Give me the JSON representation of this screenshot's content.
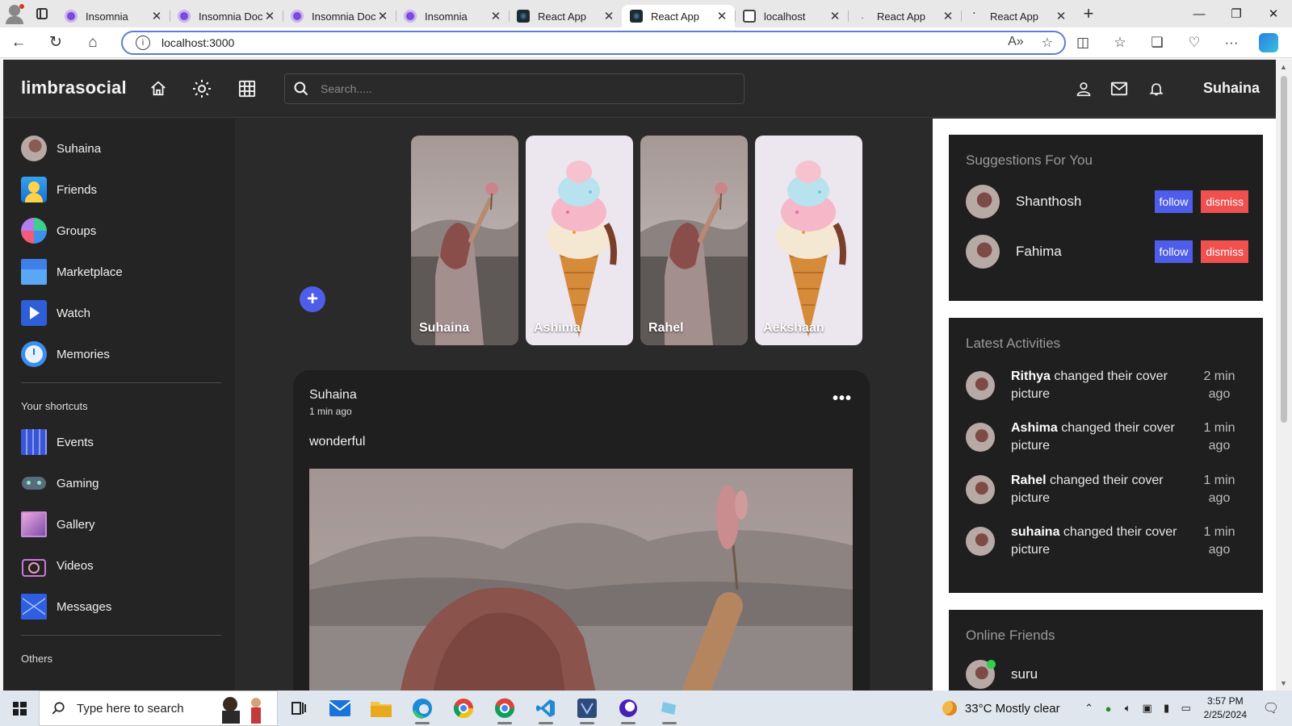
{
  "browser": {
    "tabs": [
      {
        "label": "Insomnia",
        "icon": "insomnia-icon",
        "active": false
      },
      {
        "label": "Insomnia Doc",
        "icon": "insomnia-icon",
        "active": false
      },
      {
        "label": "Insomnia Doc",
        "icon": "insomnia-icon",
        "active": false
      },
      {
        "label": "Insomnia",
        "icon": "insomnia-icon",
        "active": false
      },
      {
        "label": "React App",
        "icon": "react-icon",
        "active": false
      },
      {
        "label": "React App",
        "icon": "react-icon",
        "active": true
      },
      {
        "label": "localhost",
        "icon": "page-icon",
        "active": false
      },
      {
        "label": "React App",
        "icon": "dot-icon",
        "active": false
      },
      {
        "label": "React App",
        "icon": "dot-icon",
        "active": false
      }
    ],
    "url": "localhost:3000",
    "accent": "#5c7fd1"
  },
  "app": {
    "brand": "limbrasocial",
    "search_placeholder": "Search.....",
    "user_name": "Suhaina",
    "accent": "#4e5eea",
    "danger": "#f0514f"
  },
  "leftbar": {
    "profile": {
      "label": "Suhaina"
    },
    "items": [
      {
        "label": "Friends",
        "icon": "friends-icon"
      },
      {
        "label": "Groups",
        "icon": "groups-icon"
      },
      {
        "label": "Marketplace",
        "icon": "marketplace-icon"
      },
      {
        "label": "Watch",
        "icon": "watch-icon"
      },
      {
        "label": "Memories",
        "icon": "memories-icon"
      }
    ],
    "shortcuts_heading": "Your shortcuts",
    "shortcuts": [
      {
        "label": "Events",
        "icon": "events-icon"
      },
      {
        "label": "Gaming",
        "icon": "gaming-icon"
      },
      {
        "label": "Gallery",
        "icon": "gallery-icon"
      },
      {
        "label": "Videos",
        "icon": "videos-icon"
      },
      {
        "label": "Messages",
        "icon": "messages-icon"
      }
    ],
    "others_heading": "Others"
  },
  "stories": [
    {
      "name": "Suhaina",
      "image": "woman-lake"
    },
    {
      "name": "Ashima",
      "image": "ice-cream"
    },
    {
      "name": "Rahel",
      "image": "woman-lake"
    },
    {
      "name": "Aekshaan",
      "image": "ice-cream"
    }
  ],
  "post": {
    "author": "Suhaina",
    "time": "1 min ago",
    "text": "wonderful"
  },
  "suggestions": {
    "title": "Suggestions For You",
    "follow_label": "follow",
    "dismiss_label": "dismiss",
    "people": [
      {
        "name": "Shanthosh"
      },
      {
        "name": "Fahima"
      }
    ]
  },
  "activities": {
    "title": "Latest Activities",
    "items": [
      {
        "name": "Rithya",
        "action": "changed their cover picture",
        "time": "2 min ago"
      },
      {
        "name": "Ashima",
        "action": "changed their cover picture",
        "time": "1 min ago"
      },
      {
        "name": "Rahel",
        "action": "changed their cover picture",
        "time": "1 min ago"
      },
      {
        "name": "suhaina",
        "action": "changed their cover picture",
        "time": "1 min ago"
      }
    ]
  },
  "online": {
    "title": "Online Friends",
    "friends": [
      {
        "name": "suru",
        "online_color": "#2bd24a"
      }
    ]
  },
  "taskbar": {
    "search_placeholder": "Type here to search",
    "weather": "33°C  Mostly clear",
    "time": "3:57 PM",
    "date": "2/25/2024"
  }
}
